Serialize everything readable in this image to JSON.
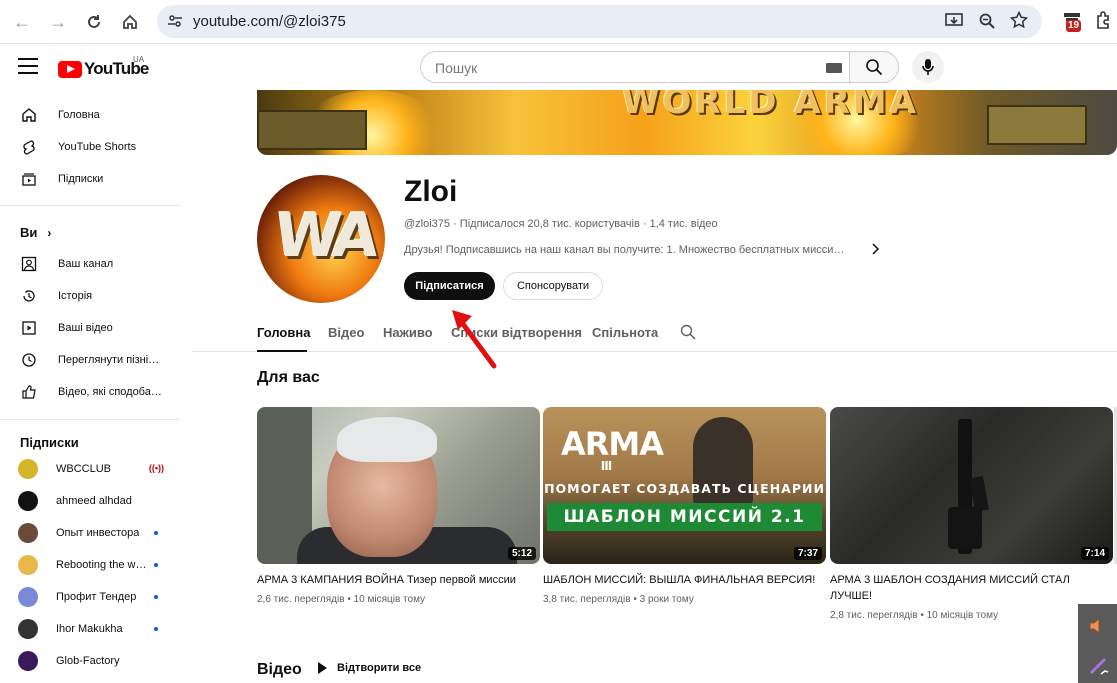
{
  "browser": {
    "url": "youtube.com/@zloi375",
    "ext_badge": "19"
  },
  "header": {
    "logo_text": "YouTube",
    "region": "UA",
    "search_placeholder": "Пошук"
  },
  "sidebar": {
    "main": [
      {
        "label": "Головна",
        "icon": "home-icon"
      },
      {
        "label": "YouTube Shorts",
        "icon": "shorts-icon"
      },
      {
        "label": "Підписки",
        "icon": "subscriptions-icon"
      }
    ],
    "you_heading": "Ви",
    "you": [
      {
        "label": "Ваш канал",
        "icon": "your-channel-icon"
      },
      {
        "label": "Історія",
        "icon": "history-icon"
      },
      {
        "label": "Ваші відео",
        "icon": "your-videos-icon"
      },
      {
        "label": "Переглянути пізні…",
        "icon": "watch-later-icon"
      },
      {
        "label": "Відео, які сподоба…",
        "icon": "liked-icon"
      }
    ],
    "subs_heading": "Підписки",
    "subscriptions": [
      {
        "label": "WBCCLUB",
        "status": "live",
        "color": "#d6b52a"
      },
      {
        "label": "ahmeed alhdad",
        "status": "",
        "color": "#111111"
      },
      {
        "label": "Опыт инвестора",
        "status": "new",
        "color": "#6b4a3a"
      },
      {
        "label": "Rebooting the w…",
        "status": "new",
        "color": "#e8b84a"
      },
      {
        "label": "Профит Тендер",
        "status": "new",
        "color": "#7a8ad8"
      },
      {
        "label": "Ihor Makukha",
        "status": "new",
        "color": "#333333"
      },
      {
        "label": "Glob-Factory",
        "status": "",
        "color": "#3a1a5a"
      }
    ]
  },
  "channel": {
    "banner_text": "WORLD ARMA",
    "avatar_text": "WA",
    "name": "Zloi",
    "meta": "@zloi375 · Підписалося 20,8 тис. користувачів · 1,4 тис. відео",
    "description": "Друзья! Подписавшись на наш канал вы получите: 1. Множество бесплатных мисси…",
    "subscribe_label": "Підписатися",
    "sponsor_label": "Спонсорувати",
    "tabs": [
      "Головна",
      "Відео",
      "Наживо",
      "Списки відтворення",
      "Спільнота"
    ]
  },
  "for_you": {
    "title": "Для вас",
    "videos": [
      {
        "title": "АРМА 3 КАМПАНИЯ ВОЙНА Тизер первой миссии",
        "duration": "5:12",
        "meta": "2,6 тис. переглядів • 10 місяців тому"
      },
      {
        "title": "ШАБЛОН МИССИЙ: ВЫШЛА ФИНАЛЬНАЯ ВЕРСИЯ!",
        "duration": "7:37",
        "meta": "3,8 тис. переглядів • 3 роки тому",
        "thumb_logo": "ARMA",
        "thumb_logo_sub": "III",
        "thumb_line1": "ПОМОГАЕТ СОЗДАВАТЬ СЦЕНАРИИ",
        "thumb_line2": "ШАБЛОН МИССИЙ 2.1"
      },
      {
        "title": "АРМА 3 ШАБЛОН СОЗДАНИЯ МИССИЙ СТАЛ ЛУЧШЕ!",
        "duration": "7:14",
        "meta": "2,8 тис. переглядів • 10 місяців тому"
      }
    ]
  },
  "videos_section": {
    "title": "Відео",
    "play_all": "Відтворити все"
  },
  "colors": {
    "accent_red": "#ff0000",
    "annotation_arrow": "#e01010",
    "link_blue": "#065fd4"
  }
}
